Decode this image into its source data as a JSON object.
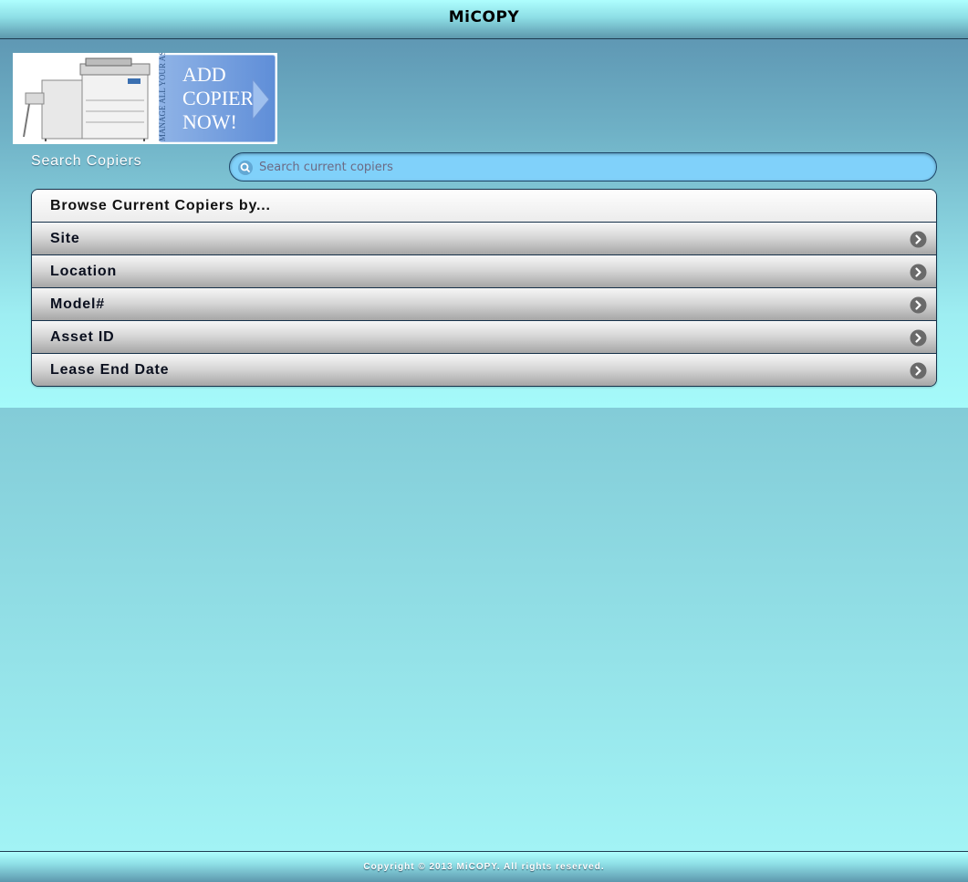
{
  "header": {
    "title": "MiCOPY"
  },
  "banner": {
    "side_text": "MANAGE ALL YOUR ASSETS",
    "line1": "ADD",
    "line2": "COPIER",
    "line3": "NOW!"
  },
  "search": {
    "label": "Search Copiers",
    "placeholder": "Search current copiers"
  },
  "browse": {
    "heading": "Browse Current Copiers by...",
    "items": [
      {
        "label": "Site"
      },
      {
        "label": "Location"
      },
      {
        "label": "Model#"
      },
      {
        "label": "Asset ID"
      },
      {
        "label": "Lease End Date"
      }
    ]
  },
  "footer": {
    "copyright": "Copyright © 2013 MiCOPY. All rights reserved."
  }
}
